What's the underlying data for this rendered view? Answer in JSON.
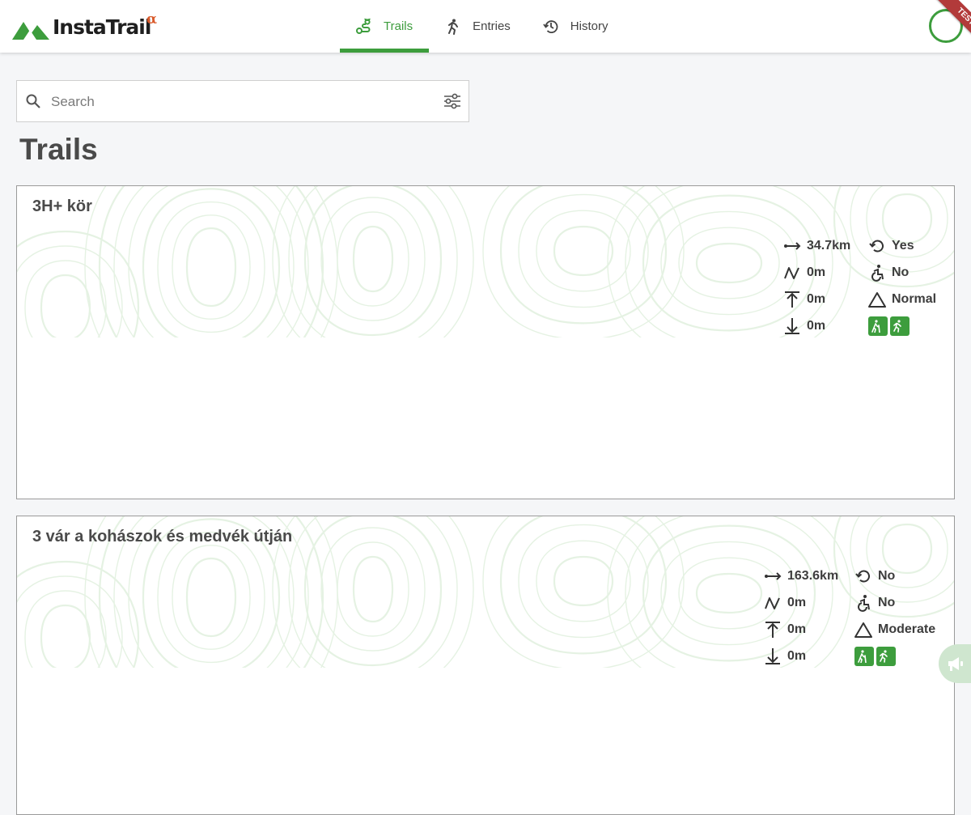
{
  "app": {
    "name": "InstaTrail",
    "badge": "α",
    "env_label": "TEST"
  },
  "nav": {
    "tabs": [
      {
        "label": "Trails",
        "icon": "route-icon",
        "active": true
      },
      {
        "label": "Entries",
        "icon": "runner-icon",
        "active": false
      },
      {
        "label": "History",
        "icon": "history-icon",
        "active": false
      }
    ]
  },
  "search": {
    "placeholder": "Search",
    "value": ""
  },
  "page": {
    "title": "Trails"
  },
  "trails": [
    {
      "name": "3H+ kör",
      "distance": "34.7km",
      "elevation": "0m",
      "ascent": "0m",
      "descent": "0m",
      "circular": "Yes",
      "accessible": "No",
      "difficulty": "Normal",
      "activities": [
        "hiking-icon",
        "running-icon"
      ]
    },
    {
      "name": "3 vár a kohászok és medvék útján",
      "distance": "163.6km",
      "elevation": "0m",
      "ascent": "0m",
      "descent": "0m",
      "circular": "No",
      "accessible": "No",
      "difficulty": "Moderate",
      "activities": [
        "hiking-icon",
        "running-icon"
      ]
    }
  ],
  "colors": {
    "brand_green": "#3d9d3d",
    "topo_line": "#d8ecd4",
    "accent_orange": "#d95a2b",
    "ribbon_red": "#b23a3a",
    "background": "#f5f6f8"
  }
}
